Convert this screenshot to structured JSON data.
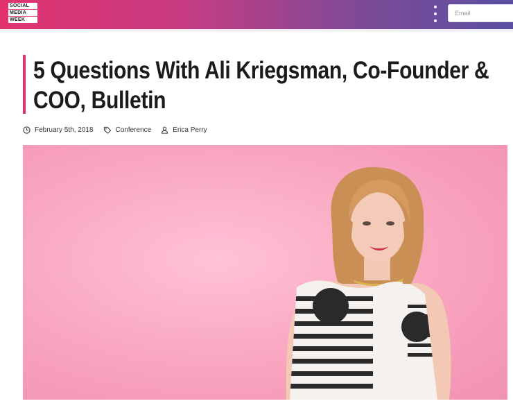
{
  "header": {
    "logo_lines": [
      "SOCIAL",
      "MEDIA",
      "WEEK"
    ],
    "menu_icon": "kebab-menu-icon",
    "email_placeholder": "Email",
    "gradient_colors": [
      "#e0336f",
      "#5b4fa3"
    ]
  },
  "article": {
    "title_line1": "5 Questions With Ali Kriegsman, Co-Founder &",
    "title_line2": "COO, Bulletin",
    "accent_color": "#e0336f",
    "meta": {
      "date": "February 5th, 2018",
      "category": "Conference",
      "author": "Erica Perry",
      "date_icon": "clock-icon",
      "category_icon": "tag-icon",
      "author_icon": "user-icon"
    },
    "hero_background": "#f8a2bd"
  }
}
